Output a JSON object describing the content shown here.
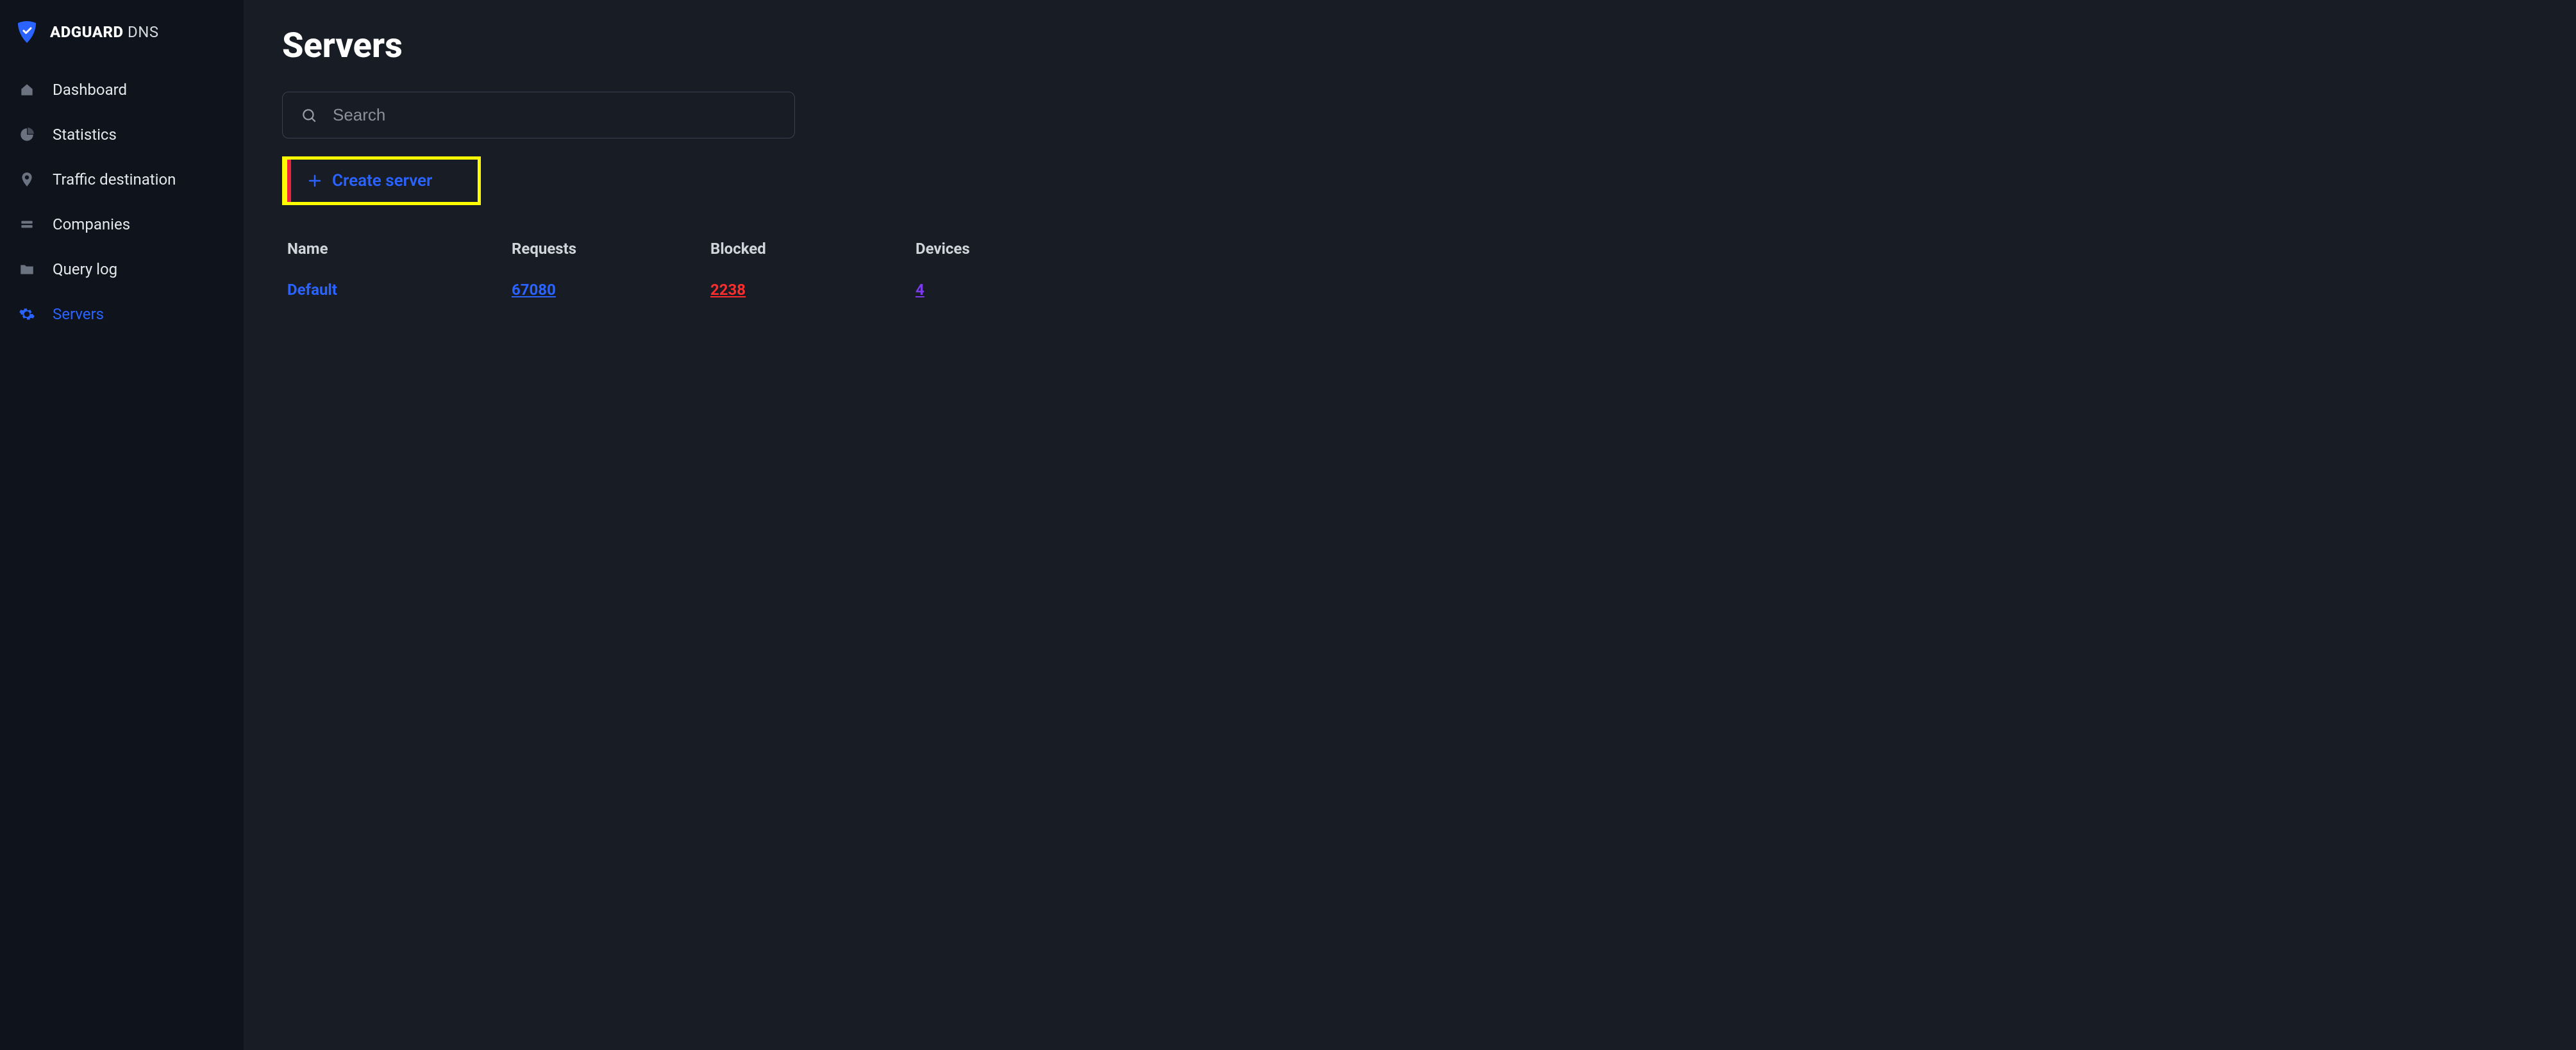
{
  "brand": {
    "bold": "ADGUARD",
    "thin": " DNS"
  },
  "sidebar": {
    "items": [
      {
        "label": "Dashboard"
      },
      {
        "label": "Statistics"
      },
      {
        "label": "Traffic destination"
      },
      {
        "label": "Companies"
      },
      {
        "label": "Query log"
      },
      {
        "label": "Servers"
      }
    ]
  },
  "page": {
    "title": "Servers",
    "search_placeholder": "Search",
    "create_label": "Create server"
  },
  "table": {
    "headers": {
      "name": "Name",
      "requests": "Requests",
      "blocked": "Blocked",
      "devices": "Devices"
    },
    "rows": [
      {
        "name": "Default",
        "requests": "67080",
        "blocked": "2238",
        "devices": "4"
      }
    ]
  }
}
